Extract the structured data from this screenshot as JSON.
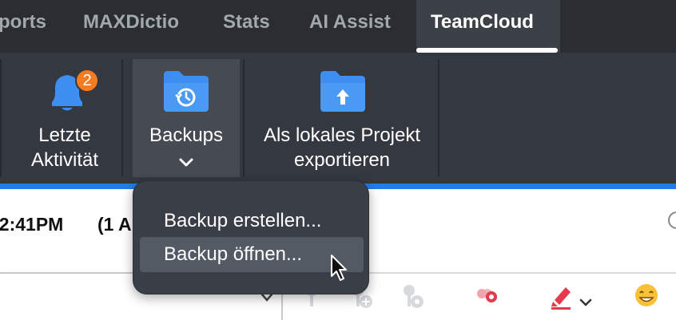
{
  "tabs": [
    {
      "label": "ports",
      "active": false
    },
    {
      "label": "MAXDictio",
      "active": false
    },
    {
      "label": "Stats",
      "active": false
    },
    {
      "label": "AI Assist",
      "active": false
    },
    {
      "label": "TeamCloud",
      "active": true
    }
  ],
  "ribbon": {
    "recent_activity": {
      "label_line1": "Letzte",
      "label_line2": "Aktivität",
      "badge": "2",
      "icon": "bell-icon"
    },
    "backups": {
      "label": "Backups",
      "icon": "folder-history-icon",
      "chevron": "chevron-down-icon"
    },
    "export": {
      "label_line1": "Als lokales Projekt",
      "label_line2": "exportieren",
      "icon": "folder-upload-icon"
    }
  },
  "content": {
    "time_text": "02:41PM",
    "paren_text": "(1 A"
  },
  "menu": {
    "items": [
      {
        "label": "Backup erstellen..."
      },
      {
        "label": "Backup öffnen..."
      }
    ]
  },
  "colors": {
    "tabbar_bg": "#2a2d32",
    "ribbon_bg": "#343840",
    "accent": "#1f7ee8",
    "badge": "#f47b20",
    "folder": "#3d8ef0"
  }
}
